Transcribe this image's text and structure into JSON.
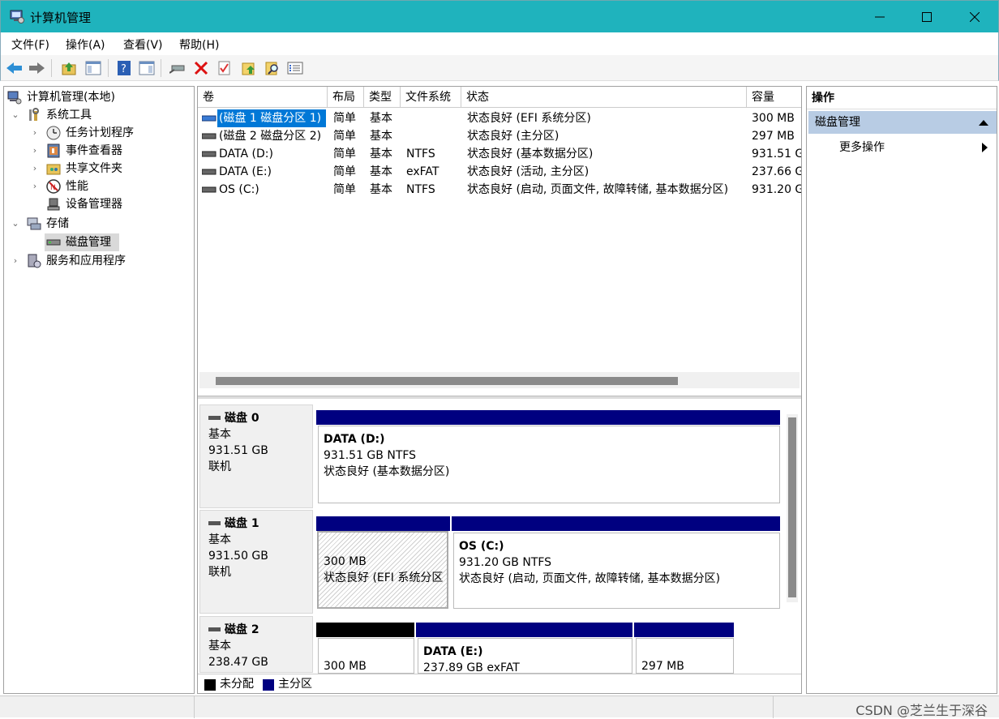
{
  "window": {
    "title": "计算机管理",
    "min_label": "—",
    "max_label": "☐",
    "close_label": "✕"
  },
  "menu": [
    "文件(F)",
    "操作(A)",
    "查看(V)",
    "帮助(H)"
  ],
  "toolbar": {
    "icons": [
      "back-icon",
      "forward-icon",
      "up-folder-icon",
      "show-hide-tree-icon",
      "help-icon",
      "properties-pane-icon",
      "connect-drive-icon",
      "delete-icon",
      "check-icon",
      "folder-up-icon",
      "search-folder-icon",
      "list-icon"
    ]
  },
  "tree": {
    "root": "计算机管理(本地)",
    "system_tools": "系统工具",
    "task_scheduler": "任务计划程序",
    "event_viewer": "事件查看器",
    "shared_folders": "共享文件夹",
    "performance": "性能",
    "device_manager": "设备管理器",
    "storage": "存储",
    "disk_management": "磁盘管理",
    "services": "服务和应用程序"
  },
  "volumes": {
    "columns": [
      "卷",
      "布局",
      "类型",
      "文件系统",
      "状态",
      "容量"
    ],
    "rows": [
      {
        "name": "(磁盘 1 磁盘分区 1)",
        "layout": "简单",
        "type": "基本",
        "fs": "",
        "status": "状态良好 (EFI 系统分区)",
        "capacity": "300 MB"
      },
      {
        "name": "(磁盘 2 磁盘分区 2)",
        "layout": "简单",
        "type": "基本",
        "fs": "",
        "status": "状态良好 (主分区)",
        "capacity": "297 MB"
      },
      {
        "name": "DATA (D:)",
        "layout": "简单",
        "type": "基本",
        "fs": "NTFS",
        "status": "状态良好 (基本数据分区)",
        "capacity": "931.51 G"
      },
      {
        "name": "DATA (E:)",
        "layout": "简单",
        "type": "基本",
        "fs": "exFAT",
        "status": "状态良好 (活动, 主分区)",
        "capacity": "237.66 G"
      },
      {
        "name": "OS (C:)",
        "layout": "简单",
        "type": "基本",
        "fs": "NTFS",
        "status": "状态良好 (启动, 页面文件, 故障转储, 基本数据分区)",
        "capacity": "931.20 G"
      }
    ]
  },
  "disks": {
    "disk0": {
      "name": "磁盘 0",
      "type": "基本",
      "size": "931.51 GB",
      "state": "联机",
      "p1": {
        "title": "DATA  (D:)",
        "size": "931.51 GB NTFS",
        "status": "状态良好 (基本数据分区)"
      }
    },
    "disk1": {
      "name": "磁盘 1",
      "type": "基本",
      "size": "931.50 GB",
      "state": "联机",
      "p1": {
        "size": "300 MB",
        "status": "状态良好 (EFI 系统分区"
      },
      "p2": {
        "title": "OS  (C:)",
        "size": "931.20 GB NTFS",
        "status": "状态良好 (启动, 页面文件, 故障转储, 基本数据分区)"
      }
    },
    "disk2": {
      "name": "磁盘 2",
      "type": "基本",
      "size": "238.47 GB",
      "p1": {
        "size": "300 MB"
      },
      "p2": {
        "title": "DATA  (E:)",
        "size": "237.89 GB exFAT"
      },
      "p3": {
        "size": "297 MB"
      }
    }
  },
  "legend": {
    "unallocated": "未分配",
    "primary": "主分区"
  },
  "actions": {
    "title": "操作",
    "section": "磁盘管理",
    "more": "更多操作"
  },
  "watermark": "CSDN @芝兰生于深谷",
  "colors": {
    "titlebar": "#1fb3bd",
    "primary_partition": "#000080",
    "unallocated": "#000000",
    "selection": "#0078d7"
  }
}
